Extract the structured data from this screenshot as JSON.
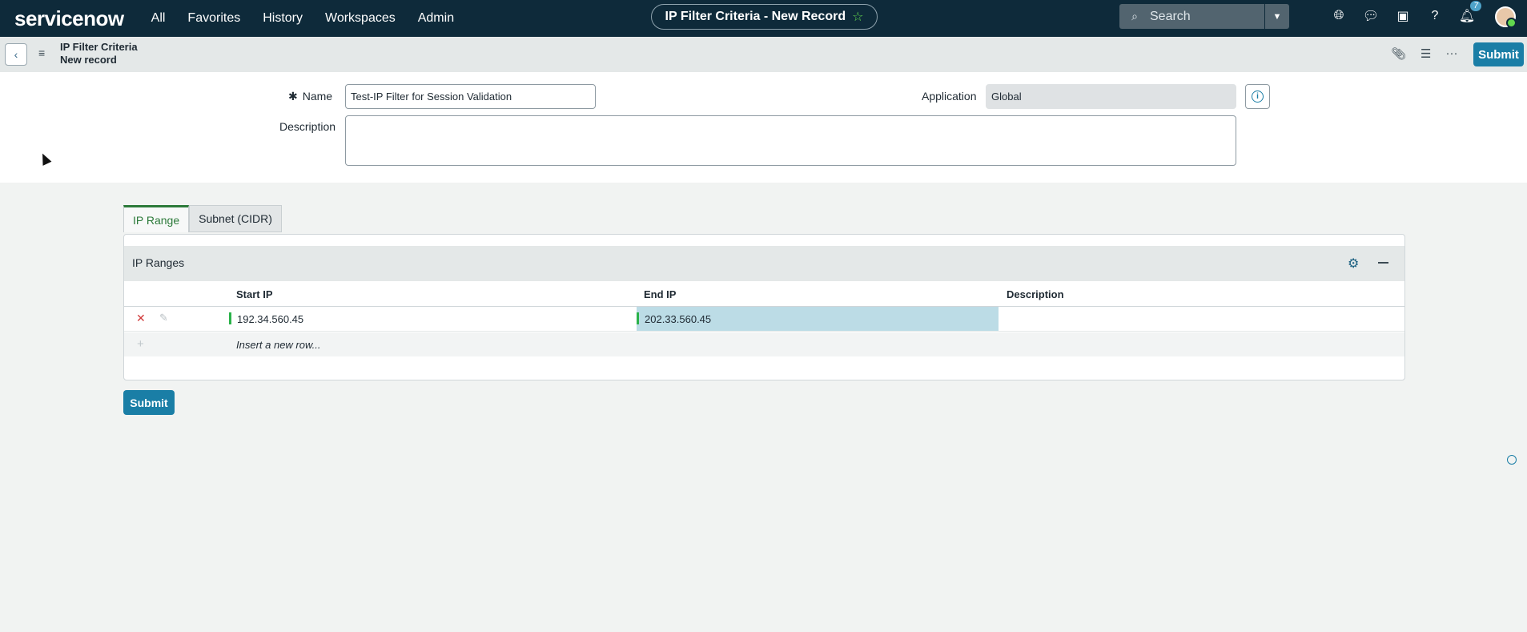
{
  "app": {
    "logo": "servicenow",
    "nav": [
      "All",
      "Favorites",
      "History",
      "Workspaces",
      "Admin"
    ],
    "record_pill": "IP Filter Criteria - New Record",
    "search_placeholder": "Search",
    "notification_count": "7"
  },
  "subheader": {
    "title_line1": "IP Filter Criteria",
    "title_line2": "New record",
    "submit_label": "Submit"
  },
  "form": {
    "name_label": "Name",
    "name_value": "Test-IP Filter for Session Validation",
    "description_label": "Description",
    "description_value": "",
    "application_label": "Application",
    "application_value": "Global"
  },
  "tabs": [
    "IP Range",
    "Subnet (CIDR)"
  ],
  "related_list": {
    "title": "IP Ranges",
    "columns": [
      "Start IP",
      "End IP",
      "Description"
    ],
    "rows": [
      {
        "start_ip": "192.34.560.45",
        "end_ip": "202.33.560.45",
        "description": ""
      }
    ],
    "insert_label": "Insert a new row..."
  },
  "footer": {
    "submit_label": "Submit"
  },
  "colors": {
    "nav_bg": "#0e2a3a",
    "accent": "#1a7ea6",
    "brand_green": "#62d84e",
    "tab_active": "#2c7a3a",
    "selected_cell": "#bcdce6"
  }
}
